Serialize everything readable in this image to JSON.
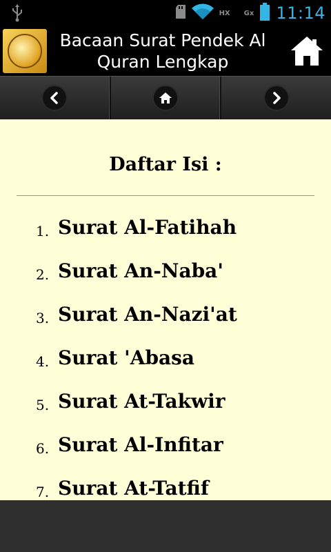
{
  "status_bar": {
    "time": "11:14",
    "network_labels": [
      "HX",
      "Gx"
    ],
    "icons": [
      "usb-icon",
      "sd-card-icon",
      "wifi-icon",
      "signal-icon",
      "battery-icon"
    ]
  },
  "title_bar": {
    "title_line1": "Bacaan Surat Pendek Al",
    "title_line2": "Quran Lengkap",
    "app_icon": "quran-icon",
    "home_icon": "home-icon"
  },
  "nav_bar": {
    "buttons": [
      "back-arrow-icon",
      "home-icon",
      "forward-arrow-icon"
    ]
  },
  "content": {
    "heading": "Daftar Isi :",
    "items": [
      {
        "num": "1.",
        "label": "Surat Al-Fatihah"
      },
      {
        "num": "2.",
        "label": "Surat An-Naba'"
      },
      {
        "num": "3.",
        "label": "Surat An-Nazi'at"
      },
      {
        "num": "4.",
        "label": "Surat 'Abasa"
      },
      {
        "num": "5.",
        "label": "Surat At-Takwir"
      },
      {
        "num": "6.",
        "label": "Surat Al-Infitar"
      },
      {
        "num": "7.",
        "label": "Surat At-Tatfif"
      }
    ]
  },
  "colors": {
    "content_bg": "#ffffd8",
    "clock": "#33b5e5",
    "bottom_bar": "#2f2f2f"
  }
}
